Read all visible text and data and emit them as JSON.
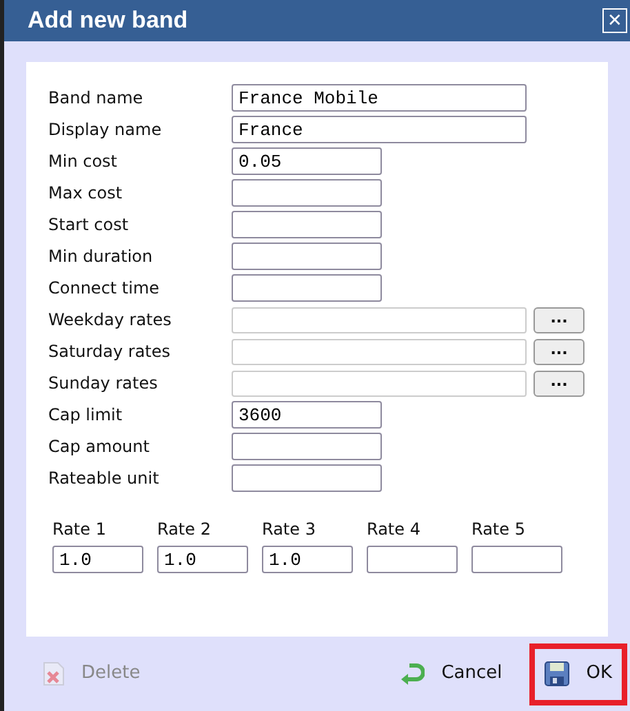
{
  "window": {
    "title": "Add new band",
    "close": "✕"
  },
  "fields": [
    {
      "label": "Band name",
      "value": "France Mobile",
      "kind": "wide"
    },
    {
      "label": "Display name",
      "value": "France",
      "kind": "wide"
    },
    {
      "label": "Min cost",
      "value": "0.05",
      "kind": "short"
    },
    {
      "label": "Max cost",
      "kind": "short"
    },
    {
      "label": "Start cost",
      "kind": "short"
    },
    {
      "label": "Min duration",
      "kind": "short"
    },
    {
      "label": "Connect time",
      "kind": "short"
    },
    {
      "label": "Weekday rates",
      "kind": "picker",
      "button": "..."
    },
    {
      "label": "Saturday rates",
      "kind": "picker",
      "button": "..."
    },
    {
      "label": "Sunday rates",
      "kind": "picker",
      "button": "..."
    },
    {
      "label": "Cap limit",
      "value": "3600",
      "kind": "short"
    },
    {
      "label": "Cap amount",
      "kind": "short"
    },
    {
      "label": "Rateable unit",
      "kind": "short"
    }
  ],
  "rates": [
    {
      "label": "Rate 1",
      "value": "1.0"
    },
    {
      "label": "Rate 2",
      "value": "1.0"
    },
    {
      "label": "Rate 3",
      "value": "1.0"
    },
    {
      "label": "Rate 4"
    },
    {
      "label": "Rate 5"
    }
  ],
  "buttons": [
    {
      "kind": "delete",
      "label": "Delete",
      "disabled": true,
      "highlighted": false
    },
    {
      "kind": "cancel",
      "label": "Cancel",
      "disabled": false,
      "highlighted": false
    },
    {
      "kind": "ok",
      "label": "OK",
      "disabled": false,
      "highlighted": true
    }
  ]
}
